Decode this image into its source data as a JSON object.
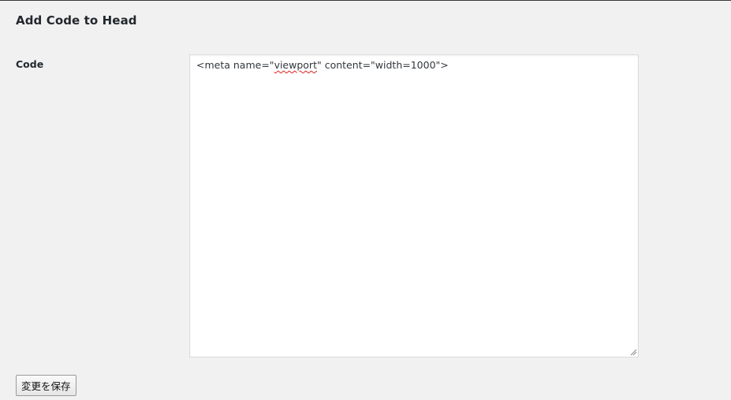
{
  "page": {
    "title": "Add Code to Head"
  },
  "form": {
    "field_label": "Code",
    "code_value_before": "<meta name=\"",
    "code_value_spellflag": "viewport",
    "code_value_after": "\" content=\"width=1000\">",
    "save_label": "変更を保存"
  }
}
